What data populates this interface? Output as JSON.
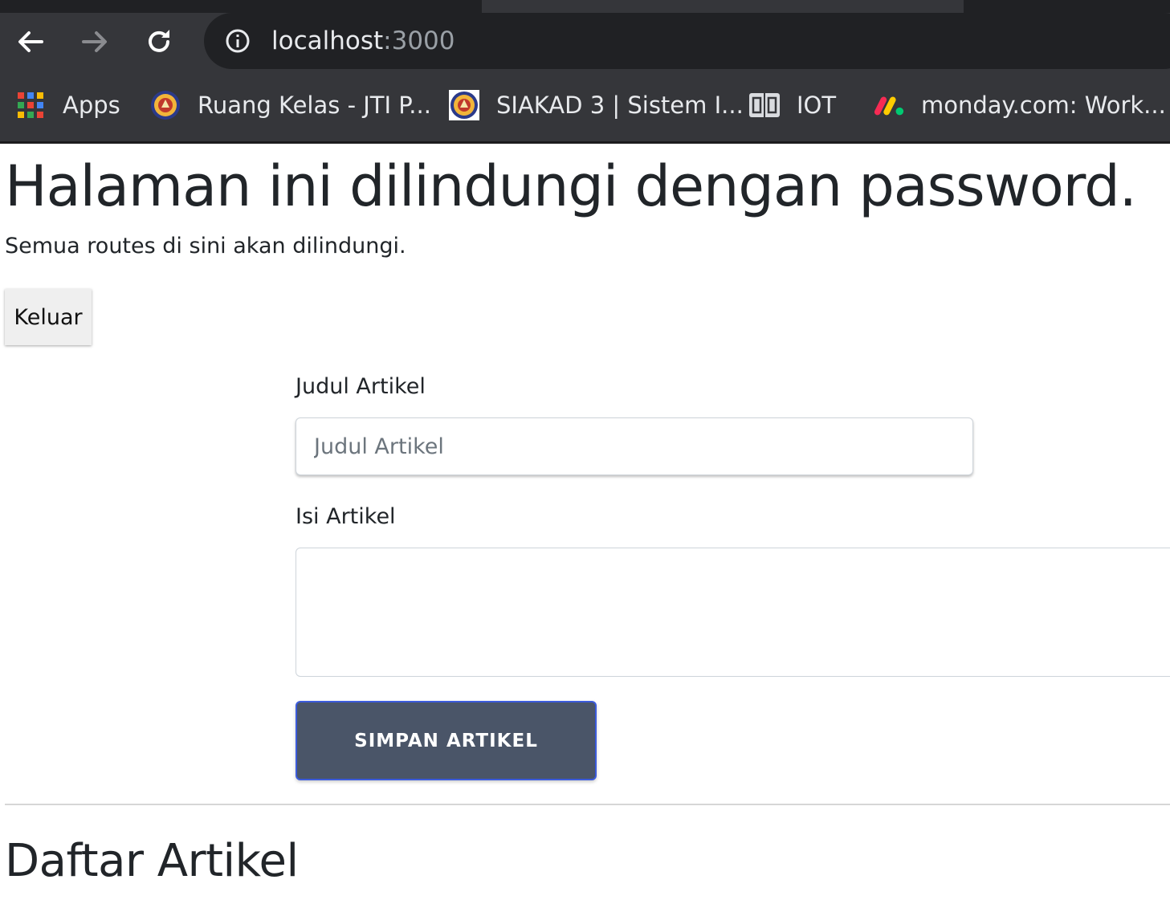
{
  "browser": {
    "url_host": "localhost",
    "url_port": ":3000",
    "bookmarks": [
      {
        "label": "Apps",
        "icon": "apps-grid-icon"
      },
      {
        "label": "Ruang Kelas - JTI P...",
        "icon": "university-seal-icon"
      },
      {
        "label": "SIAKAD 3 | Sistem I...",
        "icon": "university-seal-icon"
      },
      {
        "label": "IOT",
        "icon": "book-icon"
      },
      {
        "label": "monday.com: Work...",
        "icon": "monday-logo-icon"
      }
    ]
  },
  "page": {
    "heading": "Halaman ini dilindungi dengan password.",
    "subtitle": "Semua routes di sini akan dilindungi.",
    "logout_label": "Keluar",
    "form": {
      "title_label": "Judul Artikel",
      "title_placeholder": "Judul Artikel",
      "title_value": "",
      "body_label": "Isi Artikel",
      "body_value": "",
      "submit_label": "SIMPAN ARTIKEL"
    },
    "list_heading": "Daftar Artikel"
  },
  "colors": {
    "chrome_bg": "#35363a",
    "omnibox_bg": "#202124",
    "submit_bg": "#4a5568",
    "submit_border": "#3b5bdb"
  }
}
